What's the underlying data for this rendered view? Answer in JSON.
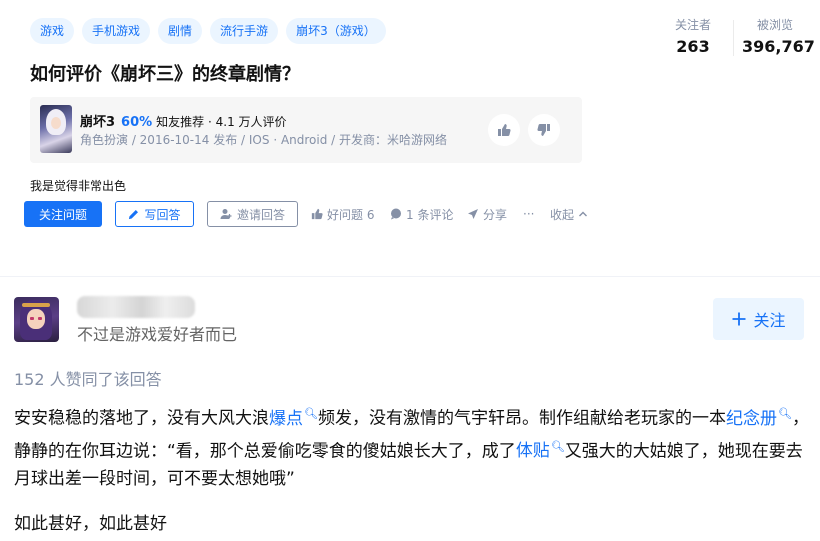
{
  "tags": [
    "游戏",
    "手机游戏",
    "剧情",
    "流行手游",
    "崩坏3（游戏）"
  ],
  "stats": {
    "followers_label": "关注者",
    "followers": "263",
    "views_label": "被浏览",
    "views": "396,767"
  },
  "question": {
    "title": "如何评价《崩坏三》的终章剧情？",
    "detail": "我是觉得非常出色"
  },
  "game_card": {
    "name": "崩坏3",
    "recommend_pct": "60%",
    "recommend_text": "知友推荐 · 4.1 万人评价",
    "meta": "角色扮演 / 2016-10-14 发布 / IOS · Android / 开发商：米哈游网络"
  },
  "actions": {
    "follow_question": "关注问题",
    "write_answer": "写回答",
    "invite": "邀请回答",
    "good_question": "好问题 6",
    "comments": "1 条评论",
    "share": "分享",
    "more": "···",
    "collapse": "收起"
  },
  "answer": {
    "author_bio": "不过是游戏爱好者而已",
    "follow_label": "关注",
    "votes": "152 人赞同了该回答",
    "p1": {
      "t1": "安安稳稳的落地了，没有大风大浪",
      "k1": "爆点",
      "t2": "频发，没有激情的气宇轩昂。制作组献给老玩家的一本",
      "k2": "纪念册",
      "t3": "，静静的在你耳边说：“看，那个总爱偷吃零食的傻姑娘长大了，成了",
      "k3": "体贴",
      "t4": "又强大的大姑娘了，她现在要去月球出差一段时间，可不要太想她哦”"
    },
    "p2": "如此甚好，如此甚好"
  },
  "colors": {
    "accent": "#1772f6",
    "tag_bg": "#ebf5ff",
    "muted": "#8590a6"
  }
}
